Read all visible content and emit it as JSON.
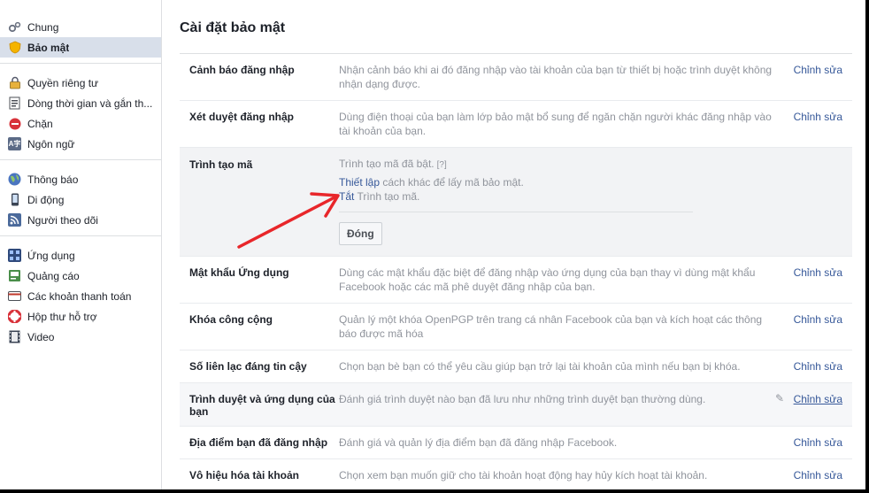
{
  "sidebar": {
    "groups": [
      [
        {
          "label": "Chung",
          "icon": "gears-icon"
        },
        {
          "label": "Bảo mật",
          "icon": "security-badge-icon",
          "active": true
        }
      ],
      [
        {
          "label": "Quyền riêng tư",
          "icon": "lock-icon"
        },
        {
          "label": "Dòng thời gian và gắn th...",
          "icon": "timeline-icon"
        },
        {
          "label": "Chặn",
          "icon": "block-icon"
        },
        {
          "label": "Ngôn ngữ",
          "icon": "language-icon"
        }
      ],
      [
        {
          "label": "Thông báo",
          "icon": "globe-icon"
        },
        {
          "label": "Di động",
          "icon": "mobile-icon"
        },
        {
          "label": "Người theo dõi",
          "icon": "rss-icon"
        }
      ],
      [
        {
          "label": "Ứng dụng",
          "icon": "apps-icon"
        },
        {
          "label": "Quảng cáo",
          "icon": "ads-icon"
        },
        {
          "label": "Các khoản thanh toán",
          "icon": "credit-card-icon"
        },
        {
          "label": "Hộp thư hỗ trợ",
          "icon": "support-lifebuoy-icon"
        },
        {
          "label": "Video",
          "icon": "film-icon"
        }
      ]
    ]
  },
  "main": {
    "title": "Cài đặt bảo mật",
    "edit_label": "Chỉnh sửa",
    "rows": {
      "login_alerts": {
        "label": "Cảnh báo đăng nhập",
        "desc": "Nhận cảnh báo khi ai đó đăng nhập vào tài khoản của bạn từ thiết bị hoặc trình duyệt không nhận dạng được."
      },
      "login_approvals": {
        "label": "Xét duyệt đăng nhập",
        "desc": "Dùng điện thoại của bạn làm lớp bảo mật bổ sung để ngăn chặn người khác đăng nhập vào tài khoản của bạn."
      },
      "code_generator": {
        "label": "Trình tạo mã",
        "status": "Trình tạo mã đã bật.",
        "help": "[?]",
        "setup_link": "Thiết lập",
        "setup_rest": " cách khác để lấy mã bảo mật.",
        "off_link": "Tắt",
        "off_rest": " Trình tạo mã.",
        "close_button": "Đóng"
      },
      "app_passwords": {
        "label": "Mật khẩu Ứng dụng",
        "desc": "Dùng các mật khẩu đặc biệt để đăng nhập vào ứng dụng của bạn thay vì dùng mật khẩu Facebook hoặc các mã phê duyệt đăng nhập của bạn."
      },
      "public_key": {
        "label": "Khóa công cộng",
        "desc": "Quản lý một khóa OpenPGP trên trang cá nhân Facebook của bạn và kích hoạt các thông báo được mã hóa"
      },
      "trusted_contacts": {
        "label": "Số liên lạc đáng tin cậy",
        "desc": "Chọn bạn bè bạn có thể yêu cầu giúp bạn trở lại tài khoản của mình nếu bạn bị khóa."
      },
      "browsers": {
        "label": "Trình duyệt và ứng dụng của bạn",
        "desc": "Đánh giá trình duyệt nào bạn đã lưu như những trình duyệt bạn thường dùng."
      },
      "logged_in_locations": {
        "label": "Địa điểm bạn đã đăng nhập",
        "desc": "Đánh giá và quản lý địa điểm bạn đã đăng nhập Facebook."
      },
      "deactivate": {
        "label": "Vô hiệu hóa tài khoản",
        "desc": "Chọn xem bạn muốn giữ cho tài khoản hoạt động hay hủy kích hoạt tài khoản."
      }
    }
  },
  "colors": {
    "link": "#365899",
    "muted_text": "#90949c",
    "active_nav_bg": "#d8dfea",
    "annotation_arrow": "#e8262a",
    "frame_border": "#000000"
  }
}
